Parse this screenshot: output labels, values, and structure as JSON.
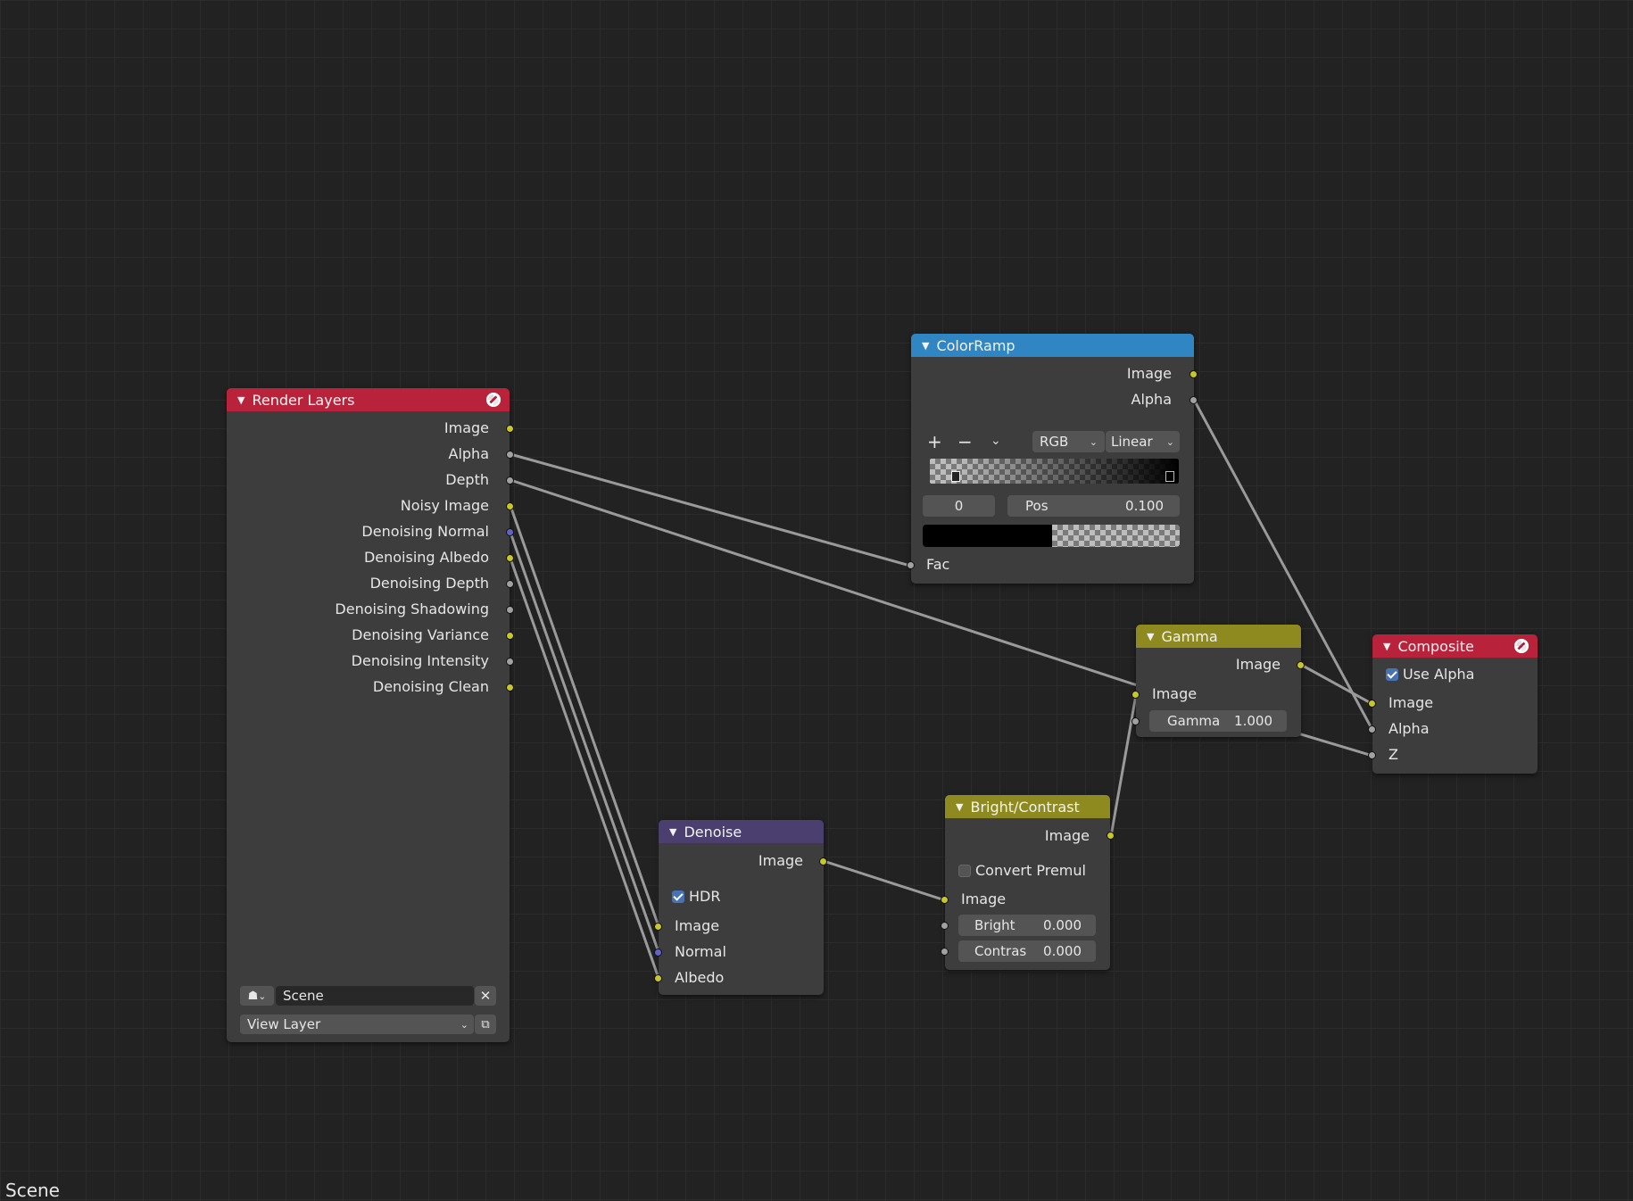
{
  "canvas": {
    "footer_label": "Scene"
  },
  "nodes": {
    "render_layers": {
      "title": "Render Layers",
      "header_color": "#b8233b",
      "outputs": [
        "Image",
        "Alpha",
        "Depth",
        "Noisy Image",
        "Denoising Normal",
        "Denoising Albedo",
        "Denoising Depth",
        "Denoising Shadowing",
        "Denoising Variance",
        "Denoising Intensity",
        "Denoising Clean"
      ],
      "scene_value": "Scene",
      "layer_value": "View Layer"
    },
    "color_ramp": {
      "title": "ColorRamp",
      "header_color": "#2f86c2",
      "outputs": [
        "Image",
        "Alpha"
      ],
      "add_label": "+",
      "remove_label": "−",
      "color_mode": "RGB",
      "interpolation": "Linear",
      "stop_index": "0",
      "pos_label": "Pos",
      "pos_value": "0.100",
      "input": "Fac"
    },
    "gamma": {
      "title": "Gamma",
      "header_color": "#8f8a1f",
      "output": "Image",
      "input": "Image",
      "gamma_label": "Gamma",
      "gamma_value": "1.000"
    },
    "composite": {
      "title": "Composite",
      "header_color": "#b8233b",
      "use_alpha_label": "Use Alpha",
      "use_alpha": true,
      "inputs": [
        "Image",
        "Alpha",
        "Z"
      ]
    },
    "denoise": {
      "title": "Denoise",
      "header_color": "#4a3f6e",
      "output": "Image",
      "hdr_label": "HDR",
      "hdr": true,
      "inputs": [
        "Image",
        "Normal",
        "Albedo"
      ]
    },
    "bright_contrast": {
      "title": "Bright/Contrast",
      "header_color": "#8f8a1f",
      "output": "Image",
      "convert_label": "Convert Premul",
      "convert": false,
      "input": "Image",
      "bright_label": "Bright",
      "bright_value": "0.000",
      "contrast_label": "Contras",
      "contrast_value": "0.000"
    }
  }
}
